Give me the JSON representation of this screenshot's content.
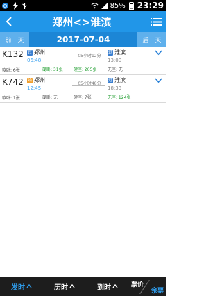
{
  "status_bar": {
    "battery_percent": "85%",
    "time": "23:29"
  },
  "header": {
    "title": "郑州<>淮滨"
  },
  "date_bar": {
    "prev_day": "前一天",
    "date": "2017-07-04",
    "next_day": "后一天"
  },
  "trains": [
    {
      "number": "K132",
      "from_station": "郑州",
      "from_badge": "过",
      "depart_time": "06:48",
      "duration": "05小时12分",
      "to_station": "淮滨",
      "to_badge": "过",
      "arrive_time": "13:00",
      "soft_sleeper": "软卧: 6张",
      "hard_sleeper": "硬卧: 31张",
      "hard_seat": "硬座: 205张",
      "no_seat": "无座: 无"
    },
    {
      "number": "K742",
      "from_station": "郑州",
      "from_badge": "始",
      "depart_time": "12:45",
      "duration": "05小时48分",
      "to_station": "淮滨",
      "to_badge": "过",
      "arrive_time": "18:33",
      "soft_sleeper": "软卧: 1张",
      "hard_sleeper": "硬卧: 无",
      "hard_seat": "硬座: 7张",
      "no_seat": "无座: 124张"
    }
  ],
  "bottom_bar": {
    "depart_time_sort": "发时",
    "duration_sort": "历时",
    "arrive_time_sort": "到时",
    "price_label": "票价",
    "remaining_label": "余票"
  }
}
